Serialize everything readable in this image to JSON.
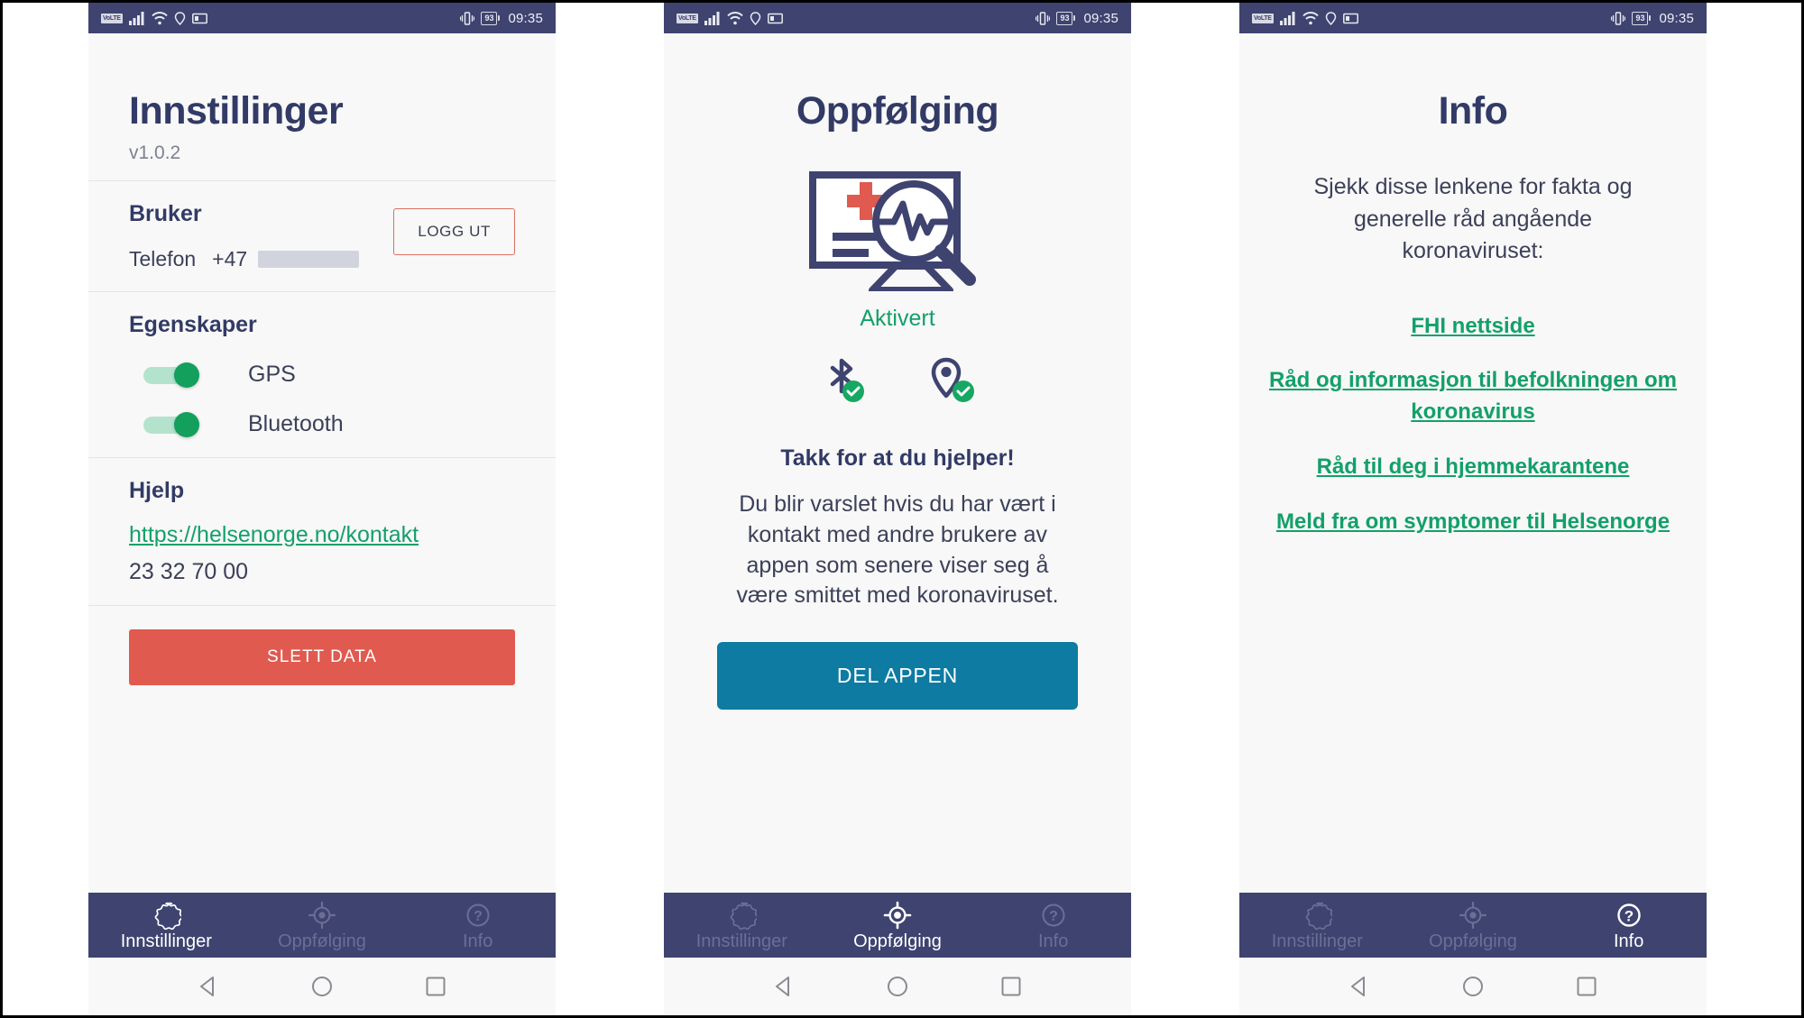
{
  "statusbar": {
    "network_label": "VoLTE",
    "icons": [
      "volte-icon",
      "signal-icon",
      "wifi-icon",
      "location-icon",
      "cast-icon",
      "vibrate-icon"
    ],
    "battery_percent": "93",
    "time": "09:35"
  },
  "colors": {
    "navy": "#3e4370",
    "title_navy": "#323a66",
    "green": "#13a06a",
    "toggle_green": "#12a05c",
    "red": "#e05a4f",
    "logout_border": "#d9705f",
    "blue_button": "#0d7ba2",
    "screen_bg": "#f8f8f8",
    "muted_tab": "#6b6f96"
  },
  "tabs": [
    {
      "label": "Innstillinger",
      "icon": "gear-icon"
    },
    {
      "label": "Oppfølging",
      "icon": "target-icon"
    },
    {
      "label": "Info",
      "icon": "question-circle-icon"
    }
  ],
  "android_nav": [
    {
      "name": "back-button",
      "icon": "triangle-left-icon"
    },
    {
      "name": "home-button",
      "icon": "circle-icon"
    },
    {
      "name": "recents-button",
      "icon": "square-icon"
    }
  ],
  "screen_settings": {
    "title": "Innstillinger",
    "version": "v1.0.2",
    "user_section": {
      "heading": "Bruker",
      "phone_label": "Telefon",
      "phone_prefix": "+47",
      "phone_value_redacted": true,
      "logout_label": "LOGG UT"
    },
    "features_section": {
      "heading": "Egenskaper",
      "toggles": [
        {
          "label": "GPS",
          "on": true
        },
        {
          "label": "Bluetooth",
          "on": true
        }
      ]
    },
    "help_section": {
      "heading": "Hjelp",
      "link": "https://helsenorge.no/kontakt",
      "phone": "23 32 70 00"
    },
    "delete_label": "SLETT DATA",
    "active_tab": 0
  },
  "screen_followup": {
    "title": "Oppfølging",
    "illustration": "monitor-ecg-magnifier-icon",
    "status_text": "Aktivert",
    "status_icons": [
      {
        "name": "bluetooth-icon",
        "badge": "check-badge"
      },
      {
        "name": "location-pin-icon",
        "badge": "check-badge"
      }
    ],
    "thanks_heading": "Takk for at du hjelper!",
    "body_text": "Du blir varslet hvis du har vært i kontakt med andre brukere av appen som senere viser seg å være smittet med koronaviruset.",
    "share_label": "DEL APPEN",
    "active_tab": 1
  },
  "screen_info": {
    "title": "Info",
    "intro": "Sjekk disse lenkene for fakta og generelle råd angående koronaviruset:",
    "links": [
      "FHI nettside ",
      " Råd og informasjon til befolkningen om koronavirus ",
      " Råd til deg i hjemmekarantene ",
      " Meld fra om symptomer til Helsenorge "
    ],
    "active_tab": 2
  }
}
